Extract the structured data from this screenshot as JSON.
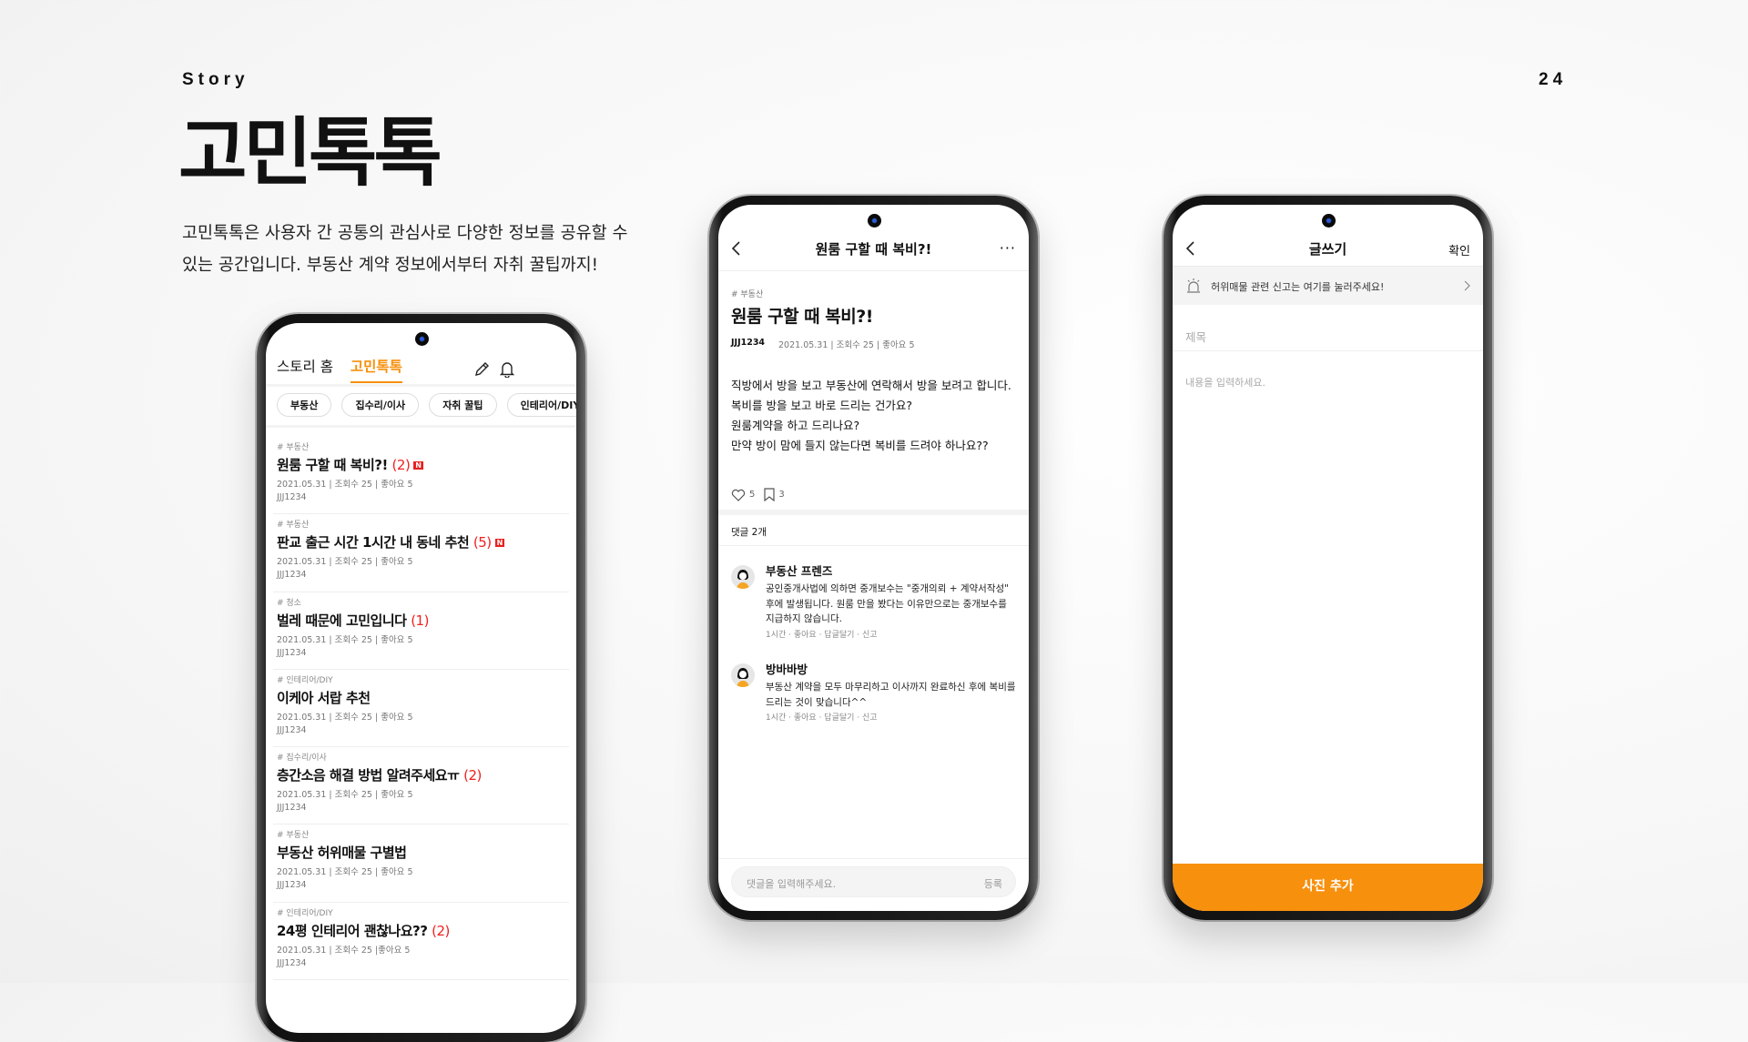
{
  "header": {
    "section": "Story",
    "page_number": "24",
    "title": "고민톡톡",
    "description_line1": "고민톡톡은 사용자 간 공통의 관심사로 다양한 정보를 공유할 수",
    "description_line2": "있는 공간입니다. 부동산 계약 정보에서부터 자취 꿀팁까지!"
  },
  "colors": {
    "accent": "#f7900d",
    "count_red": "#f02020",
    "new_badge": "#e8201e"
  },
  "list_screen": {
    "tabs": [
      {
        "label": "스토리 홈",
        "active": false
      },
      {
        "label": "고민톡톡",
        "active": true
      }
    ],
    "icons": [
      "pencil-icon",
      "bell-icon"
    ],
    "chips": [
      "부동산",
      "집수리/이사",
      "자취 꿀팁",
      "인테리어/DIY"
    ],
    "items": [
      {
        "tag": "# 부동산",
        "title": "원룸 구할 때 복비?!",
        "count": "(2)",
        "new": "N",
        "meta": "2021.05.31 | 조회수 25 | 좋아요 5",
        "author": "JJJ1234"
      },
      {
        "tag": "# 부동산",
        "title": "판교 출근 시간 1시간 내 동네 추천",
        "count": "(5)",
        "new": "N",
        "meta": "2021.05.31 | 조회수 25 | 좋아요 5",
        "author": "JJJ1234"
      },
      {
        "tag": "# 청소",
        "title": "벌레 때문에 고민입니다",
        "count": "(1)",
        "new": "",
        "meta": "2021.05.31 | 조회수 25 | 좋아요 5",
        "author": "JJJ1234"
      },
      {
        "tag": "# 인테리어/DIY",
        "title": "이케아 서랍 추천",
        "count": "",
        "new": "",
        "meta": "2021.05.31 | 조회수 25 | 좋아요 5",
        "author": "JJJ1234"
      },
      {
        "tag": "# 집수리/이사",
        "title": "층간소음 해결 방법 알려주세요ㅠ",
        "count": "(2)",
        "new": "",
        "meta": "2021.05.31 | 조회수 25 | 좋아요 5",
        "author": "JJJ1234"
      },
      {
        "tag": "# 부동산",
        "title": "부동산 허위매물 구별법",
        "count": "",
        "new": "",
        "meta": "2021.05.31 | 조회수 25 | 좋아요 5",
        "author": "JJJ1234"
      },
      {
        "tag": "# 인테리어/DIY",
        "title": "24평 인테리어 괜찮나요??",
        "count": "(2)",
        "new": "",
        "meta": "2021.05.31 | 조회수 25 |좋아요 5",
        "author": "JJJ1234"
      }
    ]
  },
  "detail_screen": {
    "header_title": "원룸 구할 때 복비?!",
    "tag": "# 부동산",
    "title": "원룸 구할 때 복비?!",
    "author": "JJJ1234",
    "meta": "2021.05.31 | 조회수 25 | 좋아요 5",
    "body": [
      "직방에서 방을 보고 부동산에 연락해서 방을 보려고 합니다.",
      "복비를 방을 보고 바로 드리는 건가요?",
      "원룸계약을 하고 드리나요?",
      "만약 방이 맘에 들지 않는다면 복비를 드려야 하나요??"
    ],
    "likes": "5",
    "bookmarks": "3",
    "comments_label": "댓글 2개",
    "comments": [
      {
        "name": "부동산 프렌즈",
        "text": "공인중개사법에 의하면 중개보수는 \"중개의뢰 + 계약서작성\" 후에 발생됩니다. 원룸 만을 봤다는 이유만으로는 중개보수를 지급하지 않습니다.",
        "meta": "1시간 · 좋아요 · 답글달기 · 신고"
      },
      {
        "name": "방바바방",
        "text": "부동산 계약을 모두 마무리하고 이사까지 완료하신 후에 복비를 드리는 것이 맞습니다^^",
        "meta": "1시간 · 좋아요 · 답글달기 · 신고"
      }
    ],
    "comment_placeholder": "댓글을 입력해주세요.",
    "submit_label": "등록"
  },
  "write_screen": {
    "header_title": "글쓰기",
    "confirm_label": "확인",
    "banner": "허위매물 관련 신고는 여기를 눌러주세요!",
    "title_placeholder": "제목",
    "content_placeholder": "내용을 입력하세요.",
    "add_photo_label": "사진 추가"
  }
}
